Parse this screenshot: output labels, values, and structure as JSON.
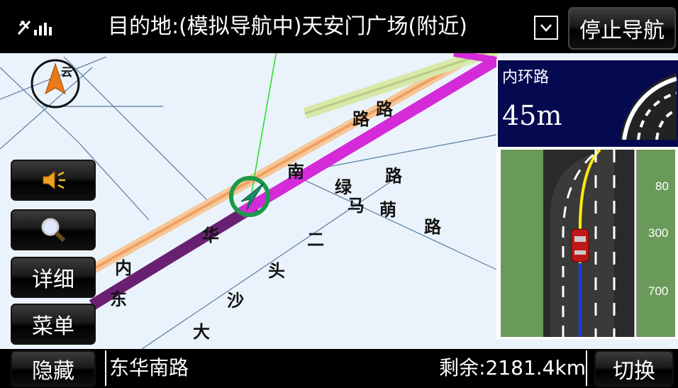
{
  "header": {
    "destination": "目的地:(模拟导航中)天安门广场(附近)",
    "stop_button": "停止导航"
  },
  "sidebar": {
    "sound_icon": "speaker-icon",
    "search_icon": "magnifier-icon",
    "detail_button": "详细",
    "menu_button": "菜单",
    "hide_button": "隐藏"
  },
  "footer": {
    "current_road": "东华南路",
    "remaining": "剩余:2181.4km",
    "switch_button": "切换"
  },
  "guidance": {
    "next_road": "内环路",
    "distance": "45m",
    "lane_markers": [
      "80",
      "300",
      "700"
    ]
  },
  "compass": {
    "label": "云"
  },
  "map_labels": {
    "lu1": "路",
    "lu2": "路",
    "nan": "南",
    "lu3": "路",
    "lu_c": "路",
    "lv": "绿",
    "ma": "马",
    "ying": "萌",
    "lu4": "路",
    "er": "二",
    "tou": "头",
    "sha": "沙",
    "da": "大",
    "nei": "内",
    "dong": "东",
    "hua": "华"
  },
  "colors": {
    "route_purple": "#6a2070",
    "route_magenta": "#d52ad8",
    "road_orange": "#f0a060",
    "map_bg": "#eaf3fb",
    "panel_blue": "#050a50",
    "nav_arrow": "#1a9a6a"
  }
}
